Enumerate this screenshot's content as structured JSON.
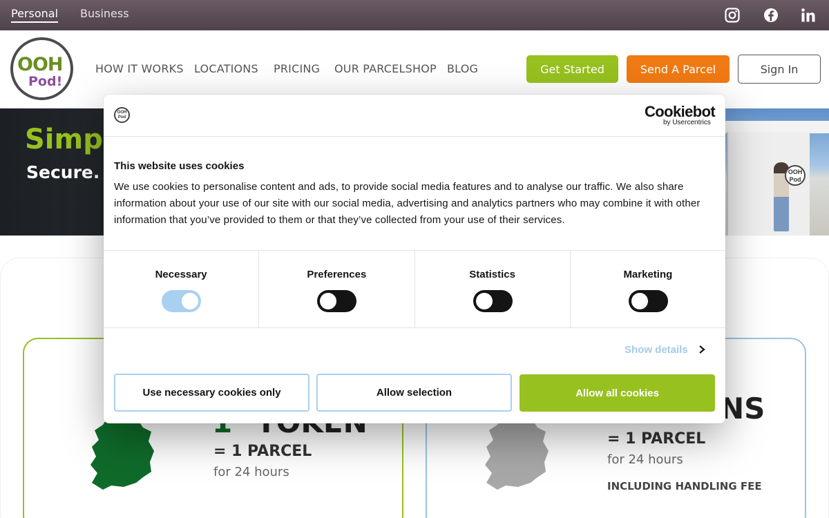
{
  "topbar": {
    "segments": [
      "Personal",
      "Business"
    ],
    "social": [
      "instagram-icon",
      "facebook-icon",
      "linkedin-icon"
    ]
  },
  "header": {
    "logo_top": "OOH",
    "logo_bottom": "Pod!",
    "nav": [
      "HOW IT WORKS",
      "LOCATIONS",
      "PRICING",
      "OUR PARCELSHOP",
      "BLOG"
    ],
    "get_started": "Get Started",
    "send_parcel": "Send A Parcel",
    "sign_in": "Sign In"
  },
  "hero": {
    "headline": "Simp",
    "subline": "Secure. C",
    "pod_logo": "OOH Pod"
  },
  "cards": {
    "left_word": "TOKEN",
    "left_token_number": "1",
    "left_parcel": "= 1 PARCEL",
    "left_hours": "for 24 hours",
    "right_word": "NS",
    "right_parcel": "= 1 PARCEL",
    "right_hours": "for 24 hours",
    "right_fee": "INCLUDING HANDLING FEE"
  },
  "cookie": {
    "brand": "Cookiebot",
    "brand_sub": "by Usercentrics",
    "logo": "OOH Pod",
    "title": "This website uses cookies",
    "text": "We use cookies to personalise content and ads, to provide social media features and to analyse our traffic. We also share information about your use of our site with our social media, advertising and analytics partners who may combine it with other information that you’ve provided to them or that they’ve collected from your use of their services.",
    "categories": [
      "Necessary",
      "Preferences",
      "Statistics",
      "Marketing"
    ],
    "show_details": "Show details",
    "btn_necessary": "Use necessary cookies only",
    "btn_selection": "Allow selection",
    "btn_all": "Allow all cookies"
  },
  "colors": {
    "brand_green": "#97c11f",
    "brand_orange": "#f07a14",
    "toggle_on": "#a9d0f1"
  }
}
